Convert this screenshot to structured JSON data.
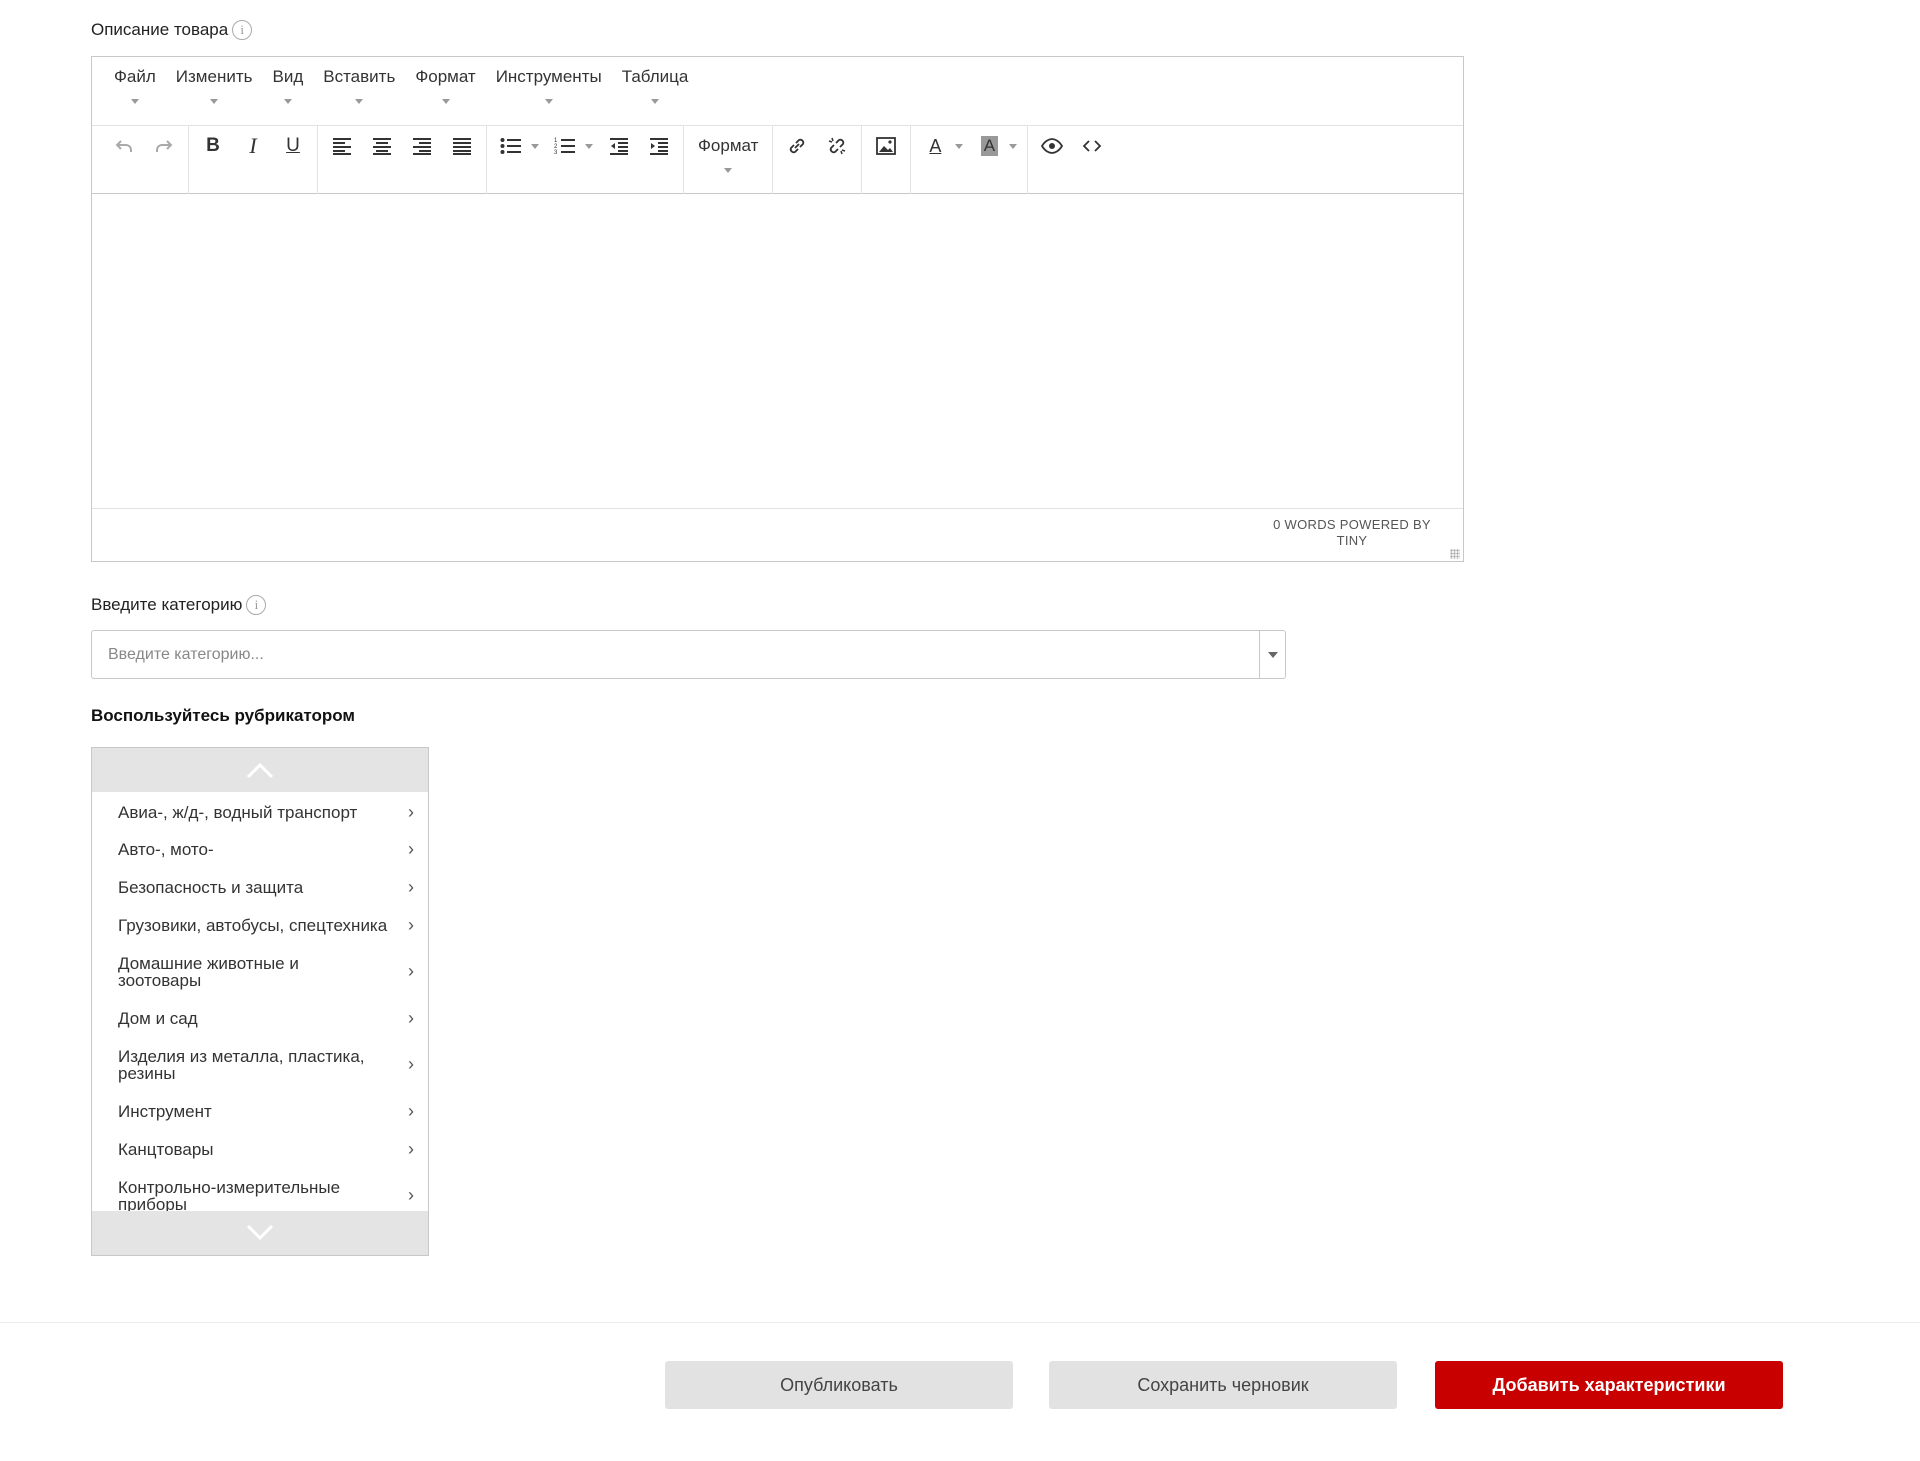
{
  "description": {
    "label": "Описание товара",
    "info": "i",
    "menu": [
      "Файл",
      "Изменить",
      "Вид",
      "Вставить",
      "Формат",
      "Инструменты",
      "Таблица"
    ],
    "toolbar_format": "Формат",
    "icons": {
      "undo": "undo-icon",
      "redo": "redo-icon",
      "bold": "B",
      "italic": "I",
      "underline": "U",
      "text_color": "A",
      "bg_color": "A"
    },
    "status": "0 WORDS POWERED BY TINY"
  },
  "category": {
    "label": "Введите категорию",
    "info": "i",
    "placeholder": "Введите категорию..."
  },
  "rubricator": {
    "title": "Воспользуйтесь рубрикатором",
    "items": [
      "Авиа-, ж/д-, водный транспорт",
      "Авто-, мото-",
      "Безопасность и защита",
      "Грузовики, автобусы, спецтехника",
      "Домашние животные и зоотовары",
      "Дом и сад",
      "Изделия из металла, пластика, резины",
      "Инструмент",
      "Канцтовары",
      "Контрольно-измерительные приборы"
    ]
  },
  "footer": {
    "publish": "Опубликовать",
    "save_draft": "Сохранить черновик",
    "add_specs": "Добавить характеристики"
  },
  "colors": {
    "primary": "#c80000",
    "secondary_button": "#e2e2e2"
  }
}
